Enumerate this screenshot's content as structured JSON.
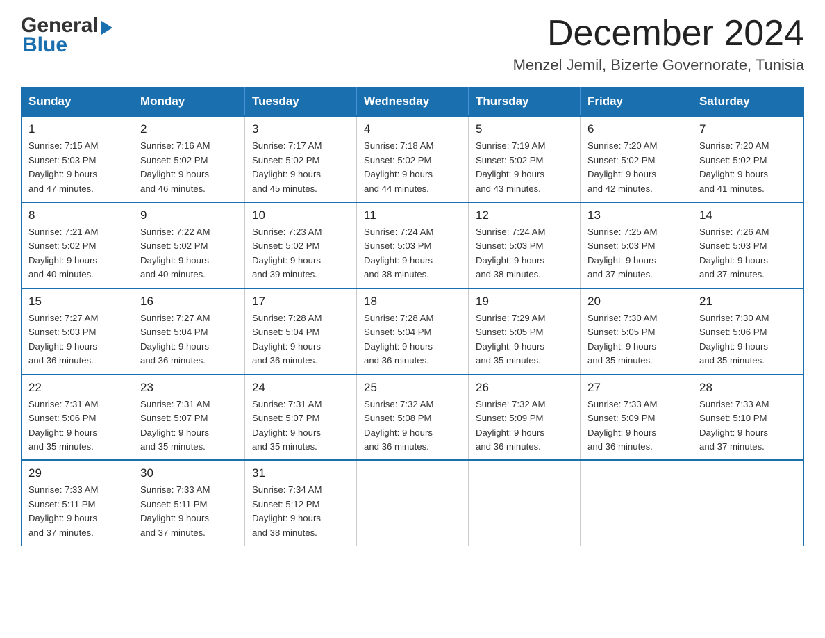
{
  "header": {
    "logo_general": "General",
    "logo_blue": "Blue",
    "title": "December 2024",
    "subtitle": "Menzel Jemil, Bizerte Governorate, Tunisia"
  },
  "weekdays": [
    "Sunday",
    "Monday",
    "Tuesday",
    "Wednesday",
    "Thursday",
    "Friday",
    "Saturday"
  ],
  "weeks": [
    [
      {
        "day": "1",
        "sunrise": "7:15 AM",
        "sunset": "5:03 PM",
        "daylight": "9 hours and 47 minutes."
      },
      {
        "day": "2",
        "sunrise": "7:16 AM",
        "sunset": "5:02 PM",
        "daylight": "9 hours and 46 minutes."
      },
      {
        "day": "3",
        "sunrise": "7:17 AM",
        "sunset": "5:02 PM",
        "daylight": "9 hours and 45 minutes."
      },
      {
        "day": "4",
        "sunrise": "7:18 AM",
        "sunset": "5:02 PM",
        "daylight": "9 hours and 44 minutes."
      },
      {
        "day": "5",
        "sunrise": "7:19 AM",
        "sunset": "5:02 PM",
        "daylight": "9 hours and 43 minutes."
      },
      {
        "day": "6",
        "sunrise": "7:20 AM",
        "sunset": "5:02 PM",
        "daylight": "9 hours and 42 minutes."
      },
      {
        "day": "7",
        "sunrise": "7:20 AM",
        "sunset": "5:02 PM",
        "daylight": "9 hours and 41 minutes."
      }
    ],
    [
      {
        "day": "8",
        "sunrise": "7:21 AM",
        "sunset": "5:02 PM",
        "daylight": "9 hours and 40 minutes."
      },
      {
        "day": "9",
        "sunrise": "7:22 AM",
        "sunset": "5:02 PM",
        "daylight": "9 hours and 40 minutes."
      },
      {
        "day": "10",
        "sunrise": "7:23 AM",
        "sunset": "5:02 PM",
        "daylight": "9 hours and 39 minutes."
      },
      {
        "day": "11",
        "sunrise": "7:24 AM",
        "sunset": "5:03 PM",
        "daylight": "9 hours and 38 minutes."
      },
      {
        "day": "12",
        "sunrise": "7:24 AM",
        "sunset": "5:03 PM",
        "daylight": "9 hours and 38 minutes."
      },
      {
        "day": "13",
        "sunrise": "7:25 AM",
        "sunset": "5:03 PM",
        "daylight": "9 hours and 37 minutes."
      },
      {
        "day": "14",
        "sunrise": "7:26 AM",
        "sunset": "5:03 PM",
        "daylight": "9 hours and 37 minutes."
      }
    ],
    [
      {
        "day": "15",
        "sunrise": "7:27 AM",
        "sunset": "5:03 PM",
        "daylight": "9 hours and 36 minutes."
      },
      {
        "day": "16",
        "sunrise": "7:27 AM",
        "sunset": "5:04 PM",
        "daylight": "9 hours and 36 minutes."
      },
      {
        "day": "17",
        "sunrise": "7:28 AM",
        "sunset": "5:04 PM",
        "daylight": "9 hours and 36 minutes."
      },
      {
        "day": "18",
        "sunrise": "7:28 AM",
        "sunset": "5:04 PM",
        "daylight": "9 hours and 36 minutes."
      },
      {
        "day": "19",
        "sunrise": "7:29 AM",
        "sunset": "5:05 PM",
        "daylight": "9 hours and 35 minutes."
      },
      {
        "day": "20",
        "sunrise": "7:30 AM",
        "sunset": "5:05 PM",
        "daylight": "9 hours and 35 minutes."
      },
      {
        "day": "21",
        "sunrise": "7:30 AM",
        "sunset": "5:06 PM",
        "daylight": "9 hours and 35 minutes."
      }
    ],
    [
      {
        "day": "22",
        "sunrise": "7:31 AM",
        "sunset": "5:06 PM",
        "daylight": "9 hours and 35 minutes."
      },
      {
        "day": "23",
        "sunrise": "7:31 AM",
        "sunset": "5:07 PM",
        "daylight": "9 hours and 35 minutes."
      },
      {
        "day": "24",
        "sunrise": "7:31 AM",
        "sunset": "5:07 PM",
        "daylight": "9 hours and 35 minutes."
      },
      {
        "day": "25",
        "sunrise": "7:32 AM",
        "sunset": "5:08 PM",
        "daylight": "9 hours and 36 minutes."
      },
      {
        "day": "26",
        "sunrise": "7:32 AM",
        "sunset": "5:09 PM",
        "daylight": "9 hours and 36 minutes."
      },
      {
        "day": "27",
        "sunrise": "7:33 AM",
        "sunset": "5:09 PM",
        "daylight": "9 hours and 36 minutes."
      },
      {
        "day": "28",
        "sunrise": "7:33 AM",
        "sunset": "5:10 PM",
        "daylight": "9 hours and 37 minutes."
      }
    ],
    [
      {
        "day": "29",
        "sunrise": "7:33 AM",
        "sunset": "5:11 PM",
        "daylight": "9 hours and 37 minutes."
      },
      {
        "day": "30",
        "sunrise": "7:33 AM",
        "sunset": "5:11 PM",
        "daylight": "9 hours and 37 minutes."
      },
      {
        "day": "31",
        "sunrise": "7:34 AM",
        "sunset": "5:12 PM",
        "daylight": "9 hours and 38 minutes."
      },
      null,
      null,
      null,
      null
    ]
  ]
}
